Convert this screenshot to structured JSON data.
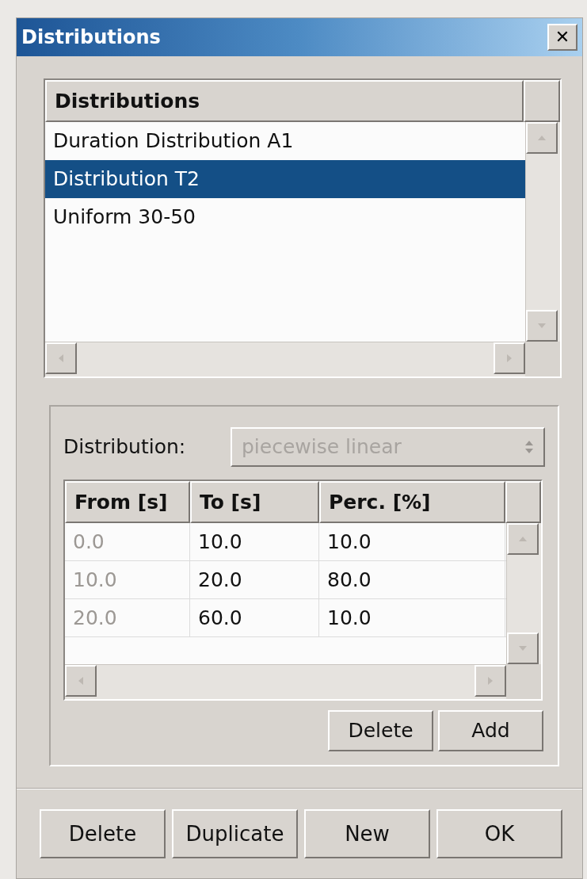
{
  "window": {
    "title": "Distributions",
    "close": "✕"
  },
  "list": {
    "header": "Distributions",
    "items": [
      {
        "label": "Duration Distribution A1",
        "selected": false
      },
      {
        "label": "Distribution T2",
        "selected": true
      },
      {
        "label": "Uniform 30-50",
        "selected": false
      }
    ]
  },
  "editor": {
    "distribution_label": "Distribution:",
    "distribution": {
      "value": "piecewise linear",
      "disabled": true
    },
    "table": {
      "columns": [
        {
          "label": "From [s]",
          "editable": false
        },
        {
          "label": "To [s]",
          "editable": true
        },
        {
          "label": "Perc. [%]",
          "editable": true
        }
      ],
      "rows": [
        [
          "0.0",
          "10.0",
          "10.0"
        ],
        [
          "10.0",
          "20.0",
          "80.0"
        ],
        [
          "20.0",
          "60.0",
          "10.0"
        ]
      ]
    },
    "buttons": [
      "Delete",
      "Add"
    ]
  },
  "buttons": [
    "Delete",
    "Duplicate",
    "New",
    "OK"
  ]
}
